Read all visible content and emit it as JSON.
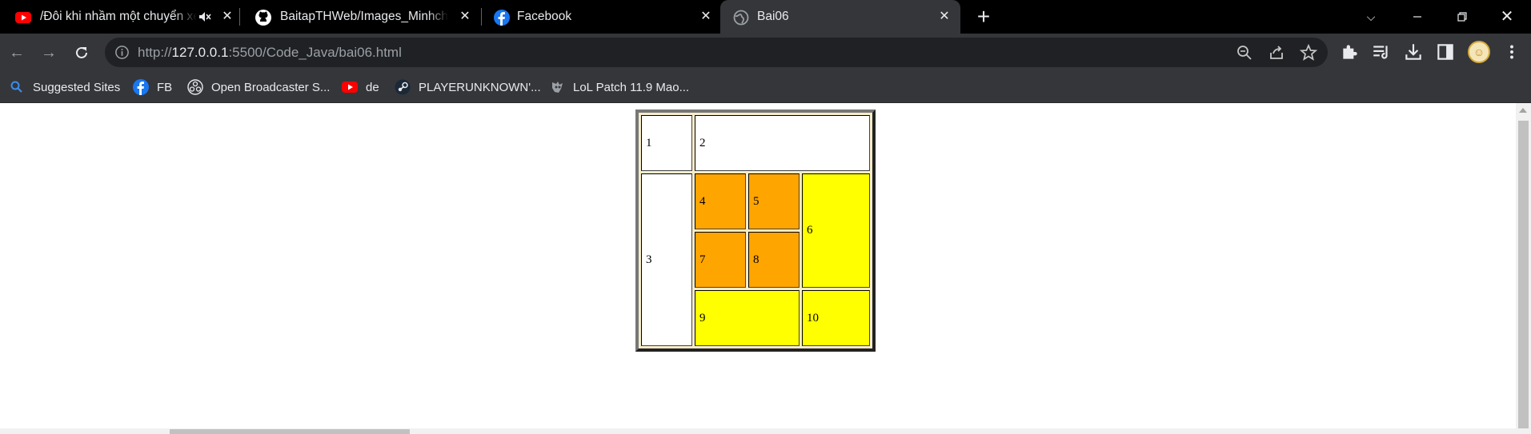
{
  "browser": {
    "tabs": [
      {
        "title": "/Đôi khi nhầm một chuyển xe",
        "icon": "youtube-icon",
        "muted": true
      },
      {
        "title": "BaitapTHWeb/Images_Minhchung",
        "icon": "github-icon"
      },
      {
        "title": "Facebook",
        "icon": "facebook-icon"
      },
      {
        "title": "Bai06",
        "icon": "globe-icon",
        "active": true
      }
    ],
    "new_tab": "+",
    "address": {
      "scheme": "http://",
      "host": "127.0.0.1",
      "rest": ":5500/Code_Java/bai06.html"
    }
  },
  "bookmarks": [
    {
      "label": "Suggested Sites",
      "icon": "search-icon"
    },
    {
      "label": "FB",
      "icon": "facebook-icon"
    },
    {
      "label": "Open Broadcaster S...",
      "icon": "obs-icon"
    },
    {
      "label": "de",
      "icon": "youtube-icon"
    },
    {
      "label": "PLAYERUNKNOWN'...",
      "icon": "steam-icon"
    },
    {
      "label": "LoL Patch 11.9 Mao...",
      "icon": "game-icon"
    }
  ],
  "table": {
    "cells": [
      "1",
      "2",
      "3",
      "4",
      "5",
      "6",
      "7",
      "8",
      "9",
      "10"
    ]
  },
  "colors": {
    "white": "#ffffff",
    "orange": "#ffa500",
    "yellow": "#ffff00"
  }
}
